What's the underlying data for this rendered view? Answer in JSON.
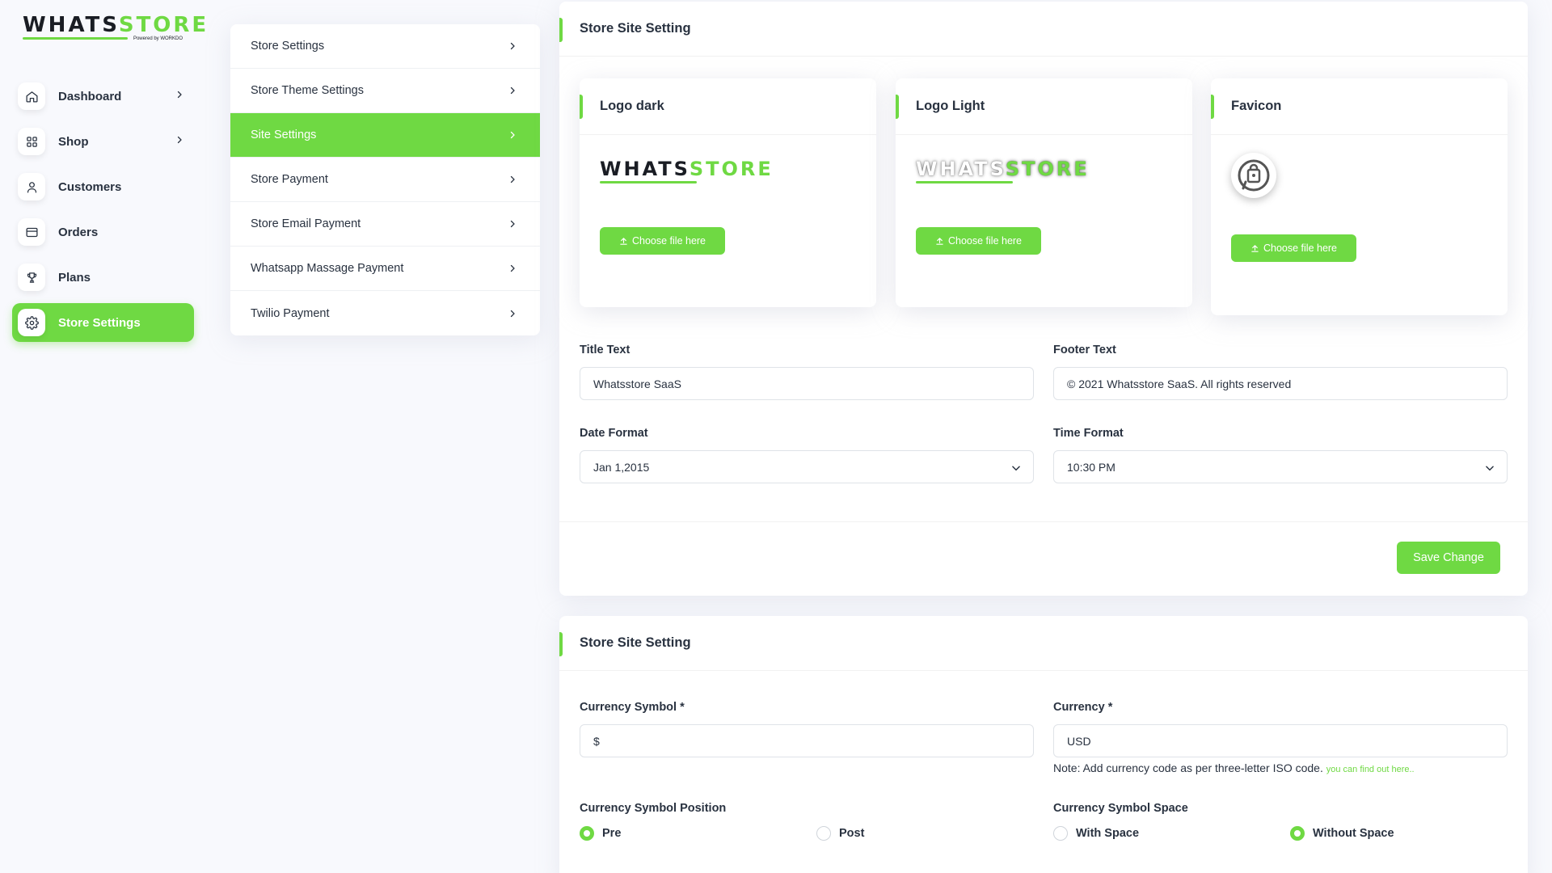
{
  "brand": {
    "name_dark": "WHATS",
    "name_green": "STORE",
    "tagline": "Powered by WORKDO"
  },
  "sidebar": {
    "items": [
      {
        "label": "Dashboard",
        "icon": "home-icon",
        "has_chevron": true
      },
      {
        "label": "Shop",
        "icon": "grid-icon",
        "has_chevron": true
      },
      {
        "label": "Customers",
        "icon": "user-icon",
        "has_chevron": false
      },
      {
        "label": "Orders",
        "icon": "credit-card-icon",
        "has_chevron": false
      },
      {
        "label": "Plans",
        "icon": "trophy-icon",
        "has_chevron": false
      },
      {
        "label": "Store Settings",
        "icon": "gear-icon",
        "has_chevron": false,
        "active": true
      }
    ]
  },
  "settings_menu": {
    "items": [
      {
        "label": "Store Settings"
      },
      {
        "label": "Store Theme Settings"
      },
      {
        "label": "Site Settings",
        "active": true
      },
      {
        "label": "Store Payment"
      },
      {
        "label": "Store Email Payment"
      },
      {
        "label": "Whatsapp Massage Payment"
      },
      {
        "label": "Twilio Payment"
      }
    ]
  },
  "site_settings": {
    "title": "Store Site Setting",
    "logo_dark": {
      "title": "Logo dark",
      "button": "Choose file here"
    },
    "logo_light": {
      "title": "Logo Light",
      "button": "Choose file here"
    },
    "favicon": {
      "title": "Favicon",
      "button": "Choose file here"
    },
    "title_text": {
      "label": "Title Text",
      "value": "Whatsstore SaaS"
    },
    "footer_text": {
      "label": "Footer Text",
      "value": "© 2021 Whatsstore SaaS. All rights reserved"
    },
    "date_format": {
      "label": "Date Format",
      "value": "Jan 1,2015"
    },
    "time_format": {
      "label": "Time Format",
      "value": "10:30 PM"
    },
    "save_button": "Save Change"
  },
  "currency_settings": {
    "title": "Store Site Setting",
    "symbol": {
      "label": "Currency Symbol *",
      "value": "$"
    },
    "currency": {
      "label": "Currency *",
      "value": "USD"
    },
    "note": "Note: Add currency code as per three-letter ISO code.",
    "note_link": "you can find out here..",
    "position": {
      "label": "Currency Symbol Position",
      "options": [
        "Pre",
        "Post"
      ],
      "selected": "Pre"
    },
    "space": {
      "label": "Currency Symbol Space",
      "options": [
        "With Space",
        "Without Space"
      ],
      "selected": "Without Space"
    }
  },
  "colors": {
    "accent": "#6fd943",
    "text": "#293240",
    "background": "#f8f9fd"
  }
}
